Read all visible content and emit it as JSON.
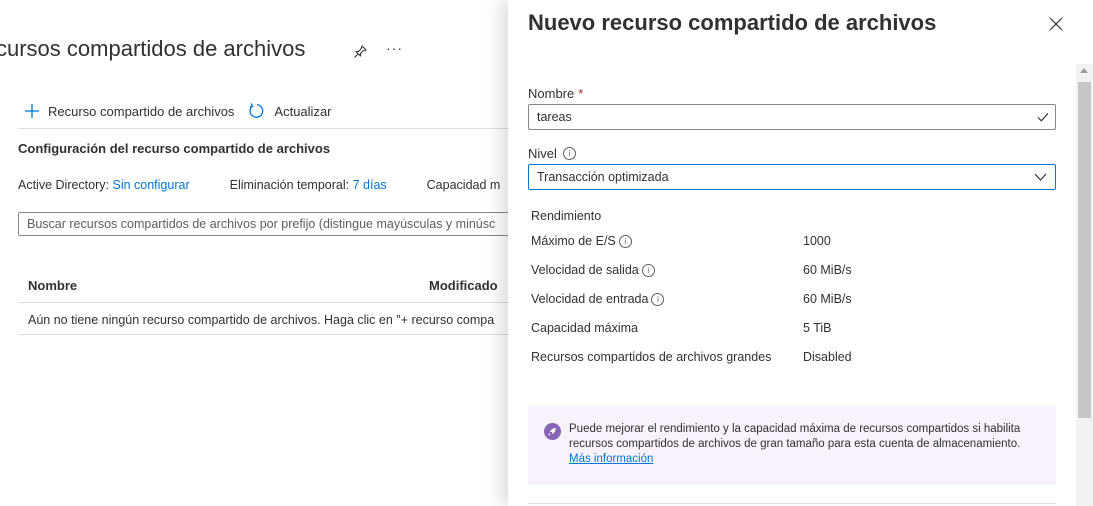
{
  "page": {
    "title": "cursos compartidos de archivos",
    "more": "···",
    "toolbar": {
      "add_label": "Recurso compartido de archivos",
      "refresh_label": "Actualizar"
    },
    "config": {
      "title": "Configuración del recurso compartido de archivos",
      "ad_label": "Active Directory:",
      "ad_value": "Sin configurar",
      "softdelete_label": "Eliminación temporal:",
      "softdelete_value": "7 días",
      "capacity_label": "Capacidad m"
    },
    "search": {
      "placeholder": "Buscar recursos compartidos de archivos por prefijo (distingue mayúsculas y minúsc"
    },
    "table": {
      "columns": [
        "Nombre",
        "Modificado"
      ],
      "empty_message": "Aún no tiene ningún recurso compartido de archivos. Haga clic en \"+ recurso compa"
    }
  },
  "panel": {
    "title": "Nuevo recurso compartido de archivos",
    "name_field": {
      "label": "Nombre",
      "required_mark": "*",
      "value": "tareas"
    },
    "tier_field": {
      "label": "Nivel",
      "info": "i",
      "value": "Transacción optimizada"
    },
    "performance": {
      "title": "Rendimiento",
      "rows": [
        {
          "label": "Máximo de E/S",
          "info": "i",
          "value": "1000"
        },
        {
          "label": "Velocidad de salida",
          "info": "i",
          "value": "60 MiB/s"
        },
        {
          "label": "Velocidad de entrada",
          "info": "i",
          "value": "60 MiB/s"
        },
        {
          "label": "Capacidad máxima",
          "value": "5 TiB"
        },
        {
          "label": "Recursos compartidos de archivos grandes",
          "value": "Disabled"
        }
      ]
    },
    "notice": {
      "text": "Puede mejorar el rendimiento y la capacidad máxima de recursos compartidos si habilita recursos compartidos de archivos de gran tamaño para esta cuenta de almacenamiento.",
      "link": "Más información"
    },
    "colors": {
      "accent": "#0078d4",
      "notice_bg": "#f8f2fc",
      "rocket": "#8764b8"
    }
  }
}
